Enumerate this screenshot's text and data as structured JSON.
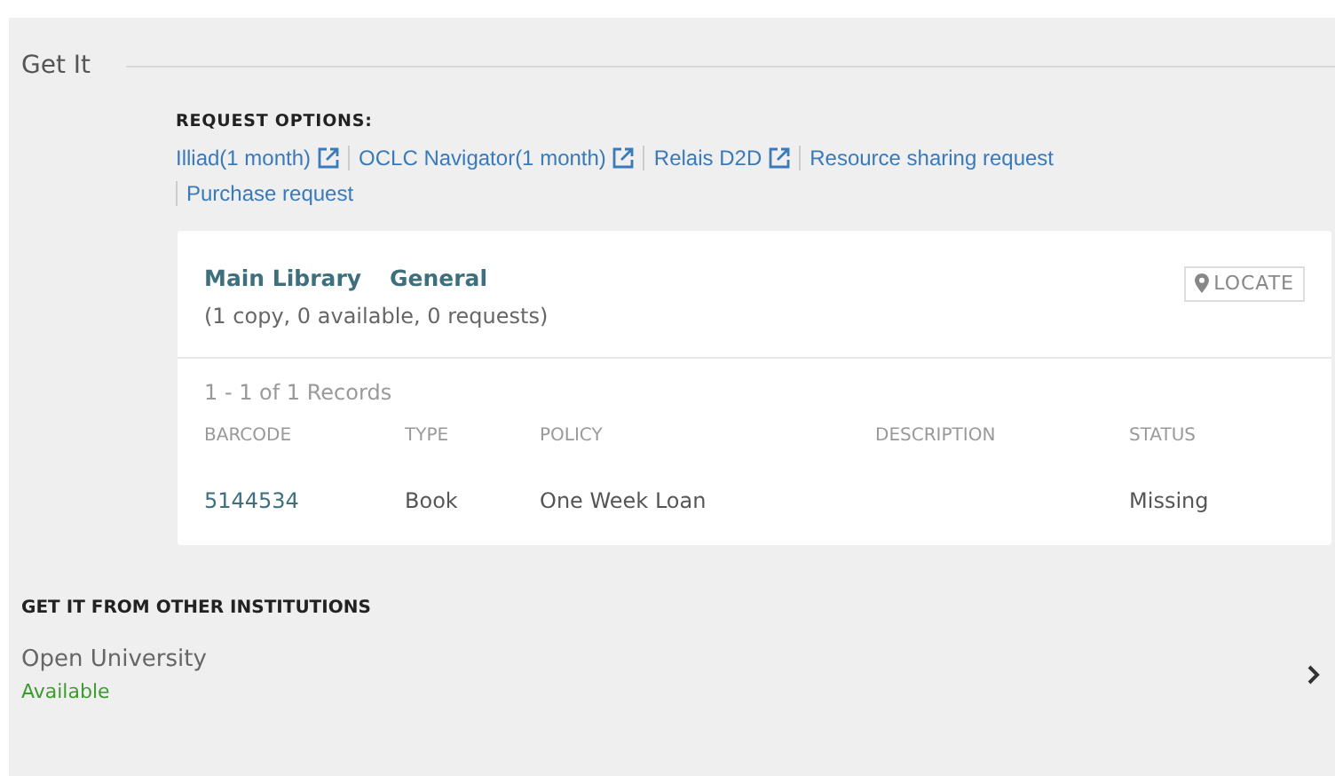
{
  "section_title": "Get It",
  "request_options": {
    "label": "REQUEST OPTIONS:",
    "links": [
      {
        "label": "Illiad(1 month)",
        "external": true
      },
      {
        "label": "OCLC Navigator(1 month)",
        "external": true
      },
      {
        "label": "Relais D2D",
        "external": true
      },
      {
        "label": "Resource sharing request",
        "external": false
      },
      {
        "label": "Purchase request",
        "external": false
      }
    ]
  },
  "location": {
    "library": "Main Library",
    "collection": "General",
    "summary": "(1 copy, 0 available, 0 requests)",
    "locate_button": "LOCATE",
    "records_count": "1 - 1 of 1 Records",
    "table": {
      "columns": [
        "BARCODE",
        "TYPE",
        "POLICY",
        "DESCRIPTION",
        "STATUS"
      ],
      "rows": [
        [
          "5144534",
          "Book",
          "One Week Loan",
          "",
          "Missing"
        ]
      ]
    }
  },
  "other_institutions": {
    "title": "GET IT FROM OTHER INSTITUTIONS",
    "items": [
      {
        "name": "Open University",
        "status": "Available",
        "color": "#3d9a2f"
      }
    ]
  }
}
